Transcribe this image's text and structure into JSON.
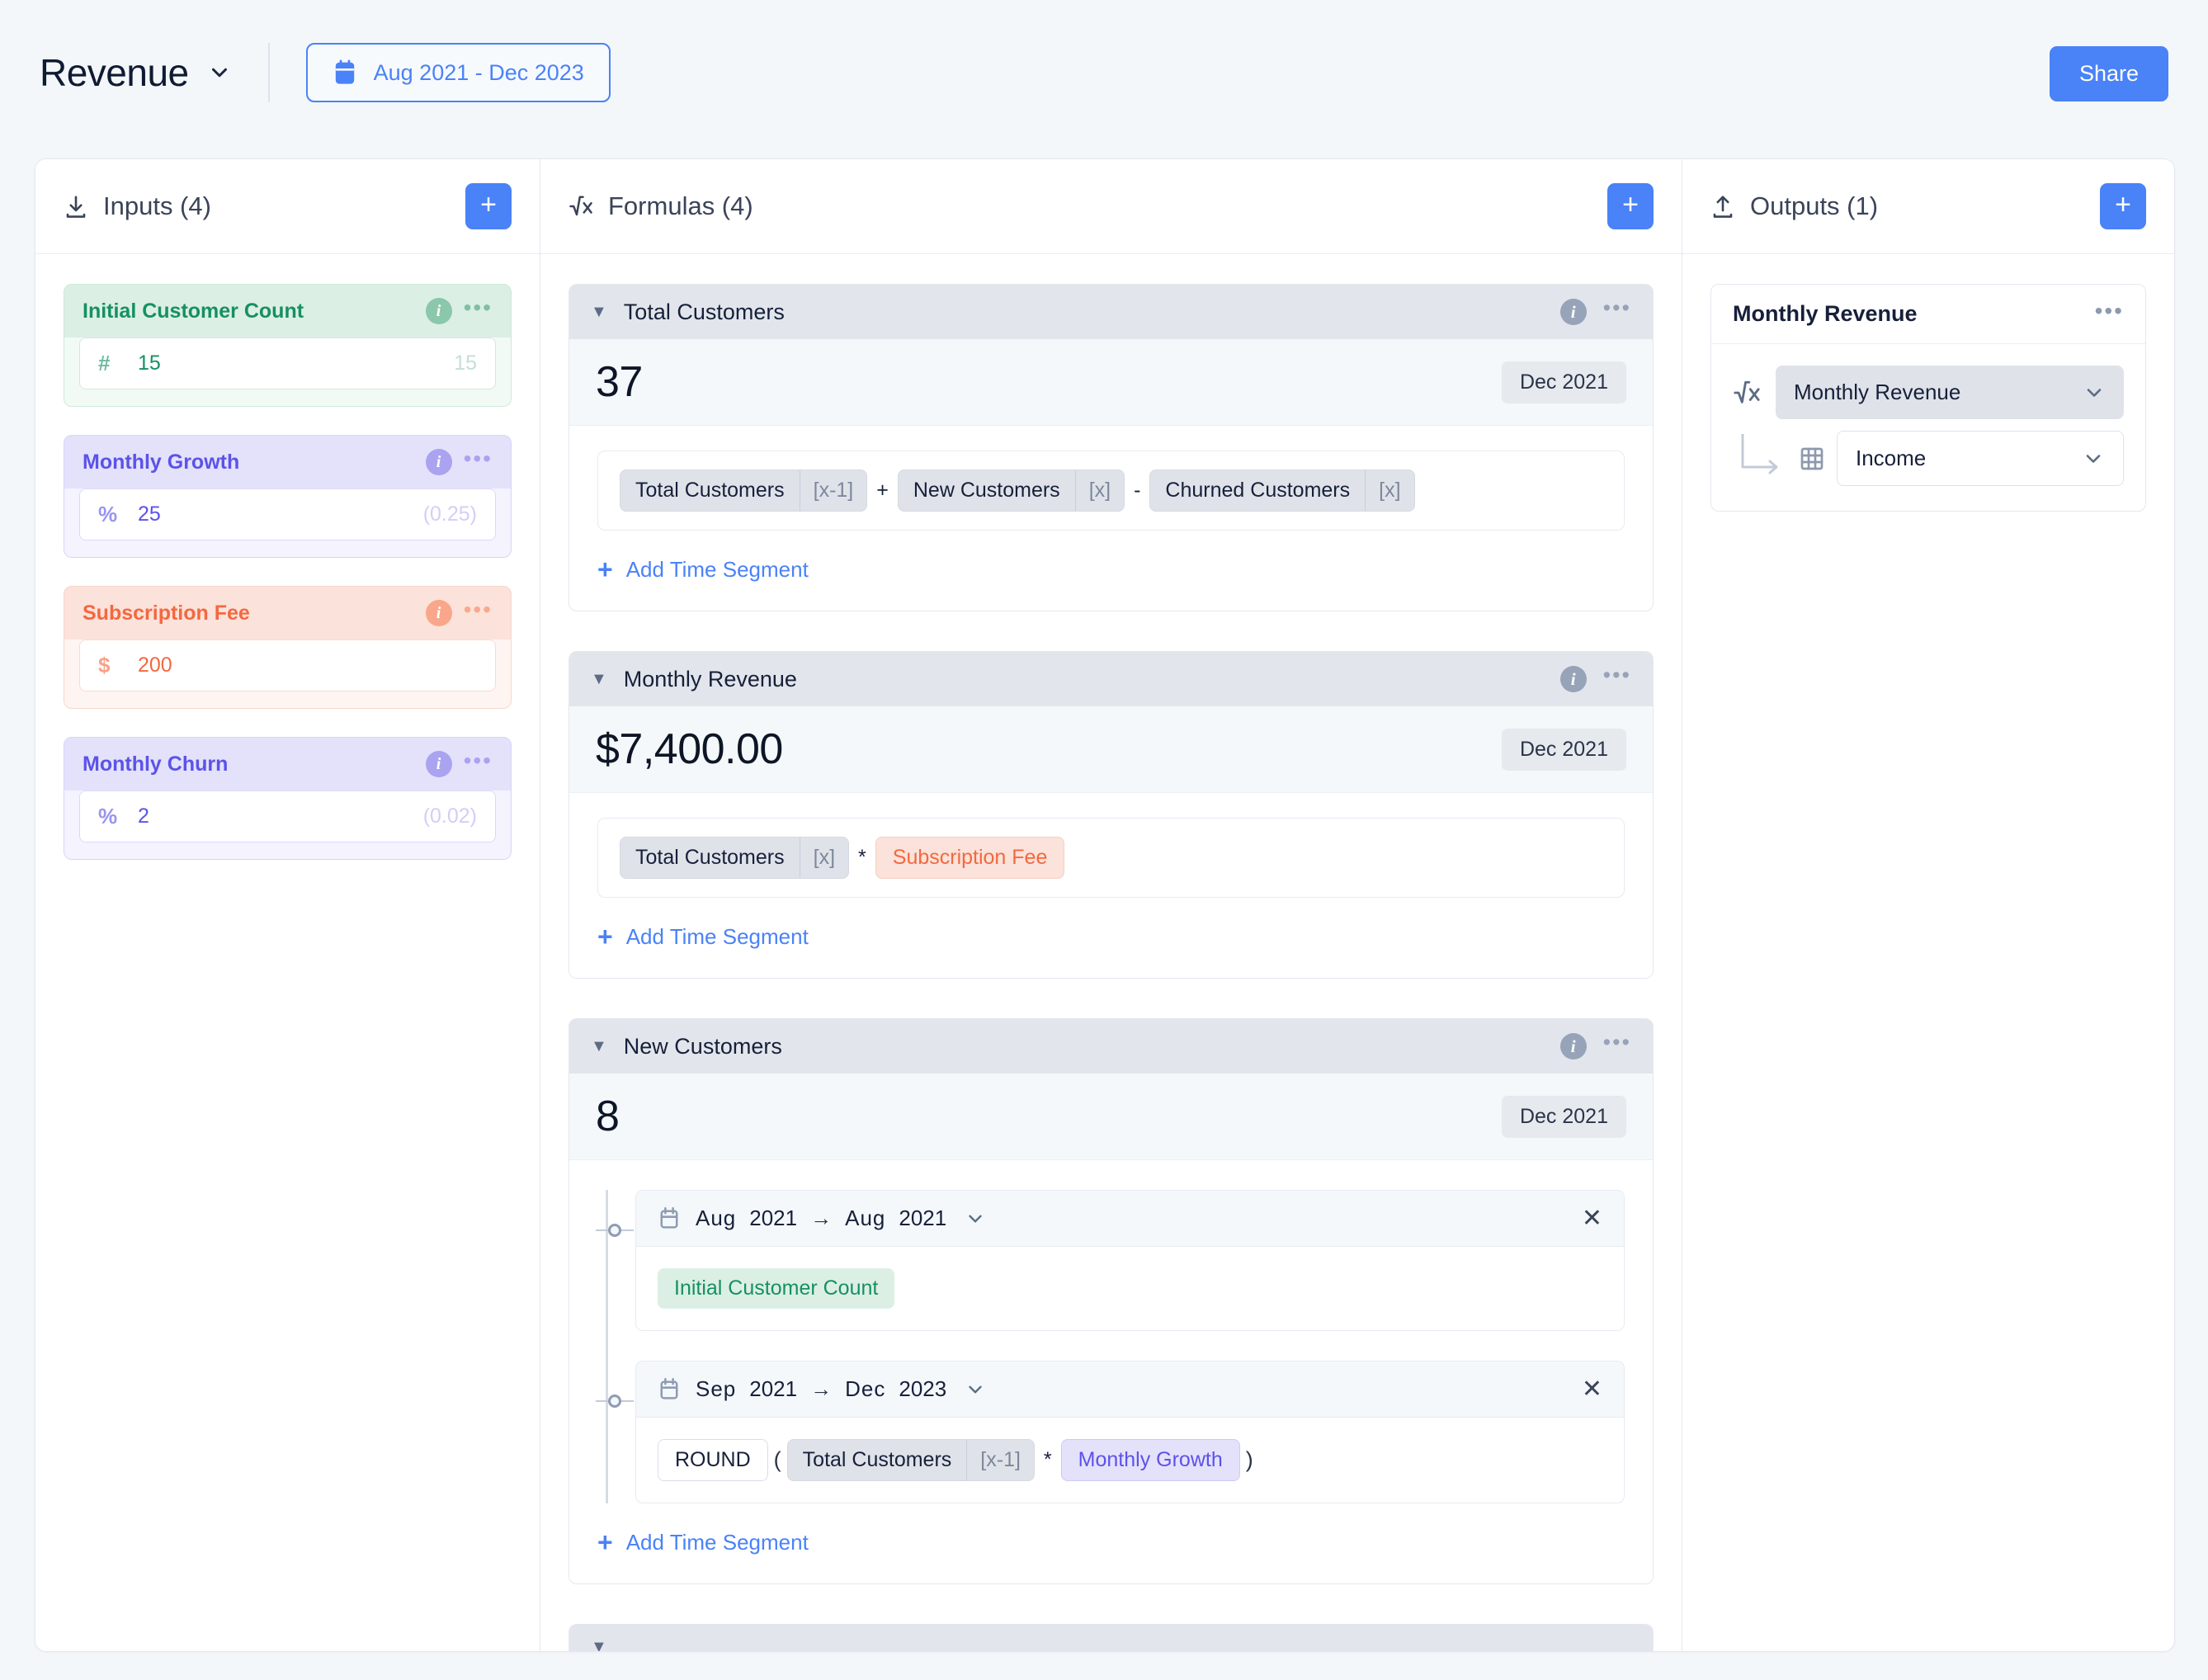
{
  "topbar": {
    "title": "Revenue",
    "date_range": "Aug 2021 - Dec 2023",
    "share_label": "Share"
  },
  "inputs_panel": {
    "header": "Inputs (4)",
    "add_label": "+",
    "items": [
      {
        "name": "Initial Customer Count",
        "theme": "green",
        "unit": "#",
        "value": "15",
        "converted": "15",
        "dots": "•••",
        "info": "i"
      },
      {
        "name": "Monthly Growth",
        "theme": "purple",
        "unit": "%",
        "value": "25",
        "converted": "(0.25)",
        "dots": "•••",
        "info": "i"
      },
      {
        "name": "Subscription Fee",
        "theme": "salmon",
        "unit": "$",
        "value": "200",
        "converted": "",
        "dots": "•••",
        "info": "i"
      },
      {
        "name": "Monthly Churn",
        "theme": "purple",
        "unit": "%",
        "value": "2",
        "converted": "(0.02)",
        "dots": "•••",
        "info": "i"
      }
    ]
  },
  "formulas_panel": {
    "header": "Formulas (4)",
    "add_label": "+",
    "add_time_segment_label": "Add Time Segment",
    "cards": [
      {
        "title": "Total Customers",
        "value": "37",
        "date": "Dec 2021",
        "expression": [
          {
            "kind": "ref",
            "label": "Total Customers",
            "offset": "[x-1]"
          },
          {
            "kind": "op",
            "label": "+"
          },
          {
            "kind": "ref",
            "label": "New Customers",
            "offset": "[x]"
          },
          {
            "kind": "op",
            "label": "-"
          },
          {
            "kind": "ref",
            "label": "Churned Customers",
            "offset": "[x]"
          }
        ]
      },
      {
        "title": "Monthly Revenue",
        "value": "$7,400.00",
        "date": "Dec 2021",
        "expression": [
          {
            "kind": "ref",
            "label": "Total Customers",
            "offset": "[x]"
          },
          {
            "kind": "op",
            "label": "*"
          },
          {
            "kind": "salmon",
            "label": "Subscription Fee"
          }
        ]
      },
      {
        "title": "New Customers",
        "value": "8",
        "date": "Dec 2021",
        "segments": [
          {
            "from_month": "Aug",
            "from_year": "2021",
            "to_month": "Aug",
            "to_year": "2021",
            "expression": [
              {
                "kind": "green",
                "label": "Initial Customer Count"
              }
            ]
          },
          {
            "from_month": "Sep",
            "from_year": "2021",
            "to_month": "Dec",
            "to_year": "2023",
            "expression": [
              {
                "kind": "fn",
                "label": "ROUND"
              },
              {
                "kind": "paren",
                "label": "("
              },
              {
                "kind": "ref",
                "label": "Total Customers",
                "offset": "[x-1]"
              },
              {
                "kind": "op",
                "label": "*"
              },
              {
                "kind": "purple",
                "label": "Monthly Growth"
              },
              {
                "kind": "paren",
                "label": ")"
              }
            ]
          }
        ]
      }
    ]
  },
  "outputs_panel": {
    "header": "Outputs (1)",
    "add_label": "+",
    "cards": [
      {
        "title": "Monthly Revenue",
        "dots": "•••",
        "formula_select": "Monthly Revenue",
        "destination_select": "Income"
      }
    ]
  },
  "colors": {
    "accent_blue": "#4a82f7",
    "green": "#169063",
    "purple": "#5b53e8",
    "salmon": "#f4683f",
    "page_bg": "#f4f7fa",
    "header_gray": "#e2e6ec"
  }
}
